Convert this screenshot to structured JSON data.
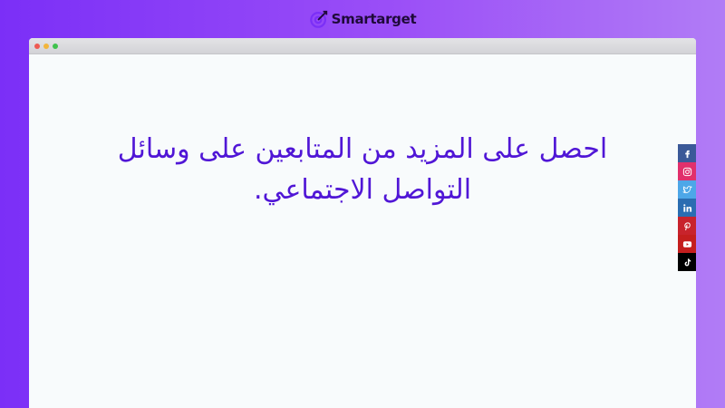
{
  "brand": {
    "name": "Smartarget",
    "logo_icon": "target-logo-icon",
    "color": "#1f0a3a"
  },
  "browser": {
    "controls": [
      "close",
      "minimize",
      "maximize"
    ]
  },
  "headline": {
    "text": "احصل على المزيد من المتابعين على وسائل التواصل الاجتماعي.",
    "color": "#5016d6"
  },
  "social": [
    {
      "network": "facebook",
      "icon": "facebook-icon",
      "color": "#3b5998"
    },
    {
      "network": "instagram",
      "icon": "instagram-icon",
      "color": "#e1306c"
    },
    {
      "network": "twitter",
      "icon": "twitter-icon",
      "color": "#4da7e8"
    },
    {
      "network": "linkedin",
      "icon": "linkedin-icon",
      "color": "#2a6db1"
    },
    {
      "network": "pinterest",
      "icon": "pinterest-icon",
      "color": "#c8232c"
    },
    {
      "network": "youtube",
      "icon": "youtube-icon",
      "color": "#c41e1e"
    },
    {
      "network": "tiktok",
      "icon": "tiktok-icon",
      "color": "#000000"
    }
  ],
  "background": {
    "gradient_start": "#7b2ff7",
    "gradient_end": "#b17cf6"
  }
}
